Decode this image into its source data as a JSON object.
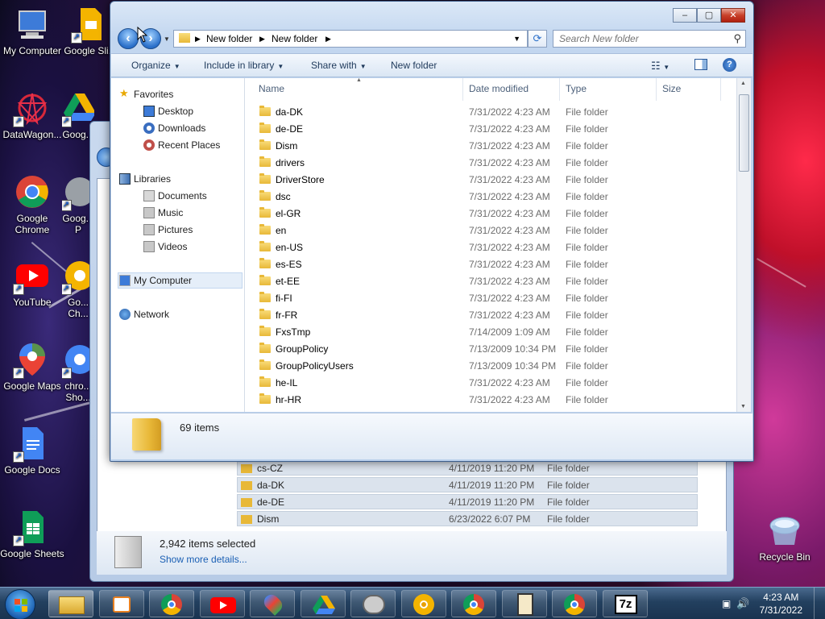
{
  "desktop": {
    "icons": [
      {
        "label": "My Computer",
        "icon": "computer-icon"
      },
      {
        "label": "Google Sli...",
        "icon": "google-slides-icon"
      },
      {
        "label": "DataWagon...",
        "icon": "datawagon-icon"
      },
      {
        "label": "Goog...",
        "icon": "google-drive-icon"
      },
      {
        "label": "Google Chrome",
        "icon": "chrome-icon"
      },
      {
        "label": "Goog... P",
        "icon": "google-pro-icon"
      },
      {
        "label": "YouTube",
        "icon": "youtube-icon"
      },
      {
        "label": "Go... Ch...",
        "icon": "chrome-canary-icon"
      },
      {
        "label": "Google Maps",
        "icon": "google-maps-icon"
      },
      {
        "label": "chro... Sho...",
        "icon": "chrome-shortcut-icon"
      },
      {
        "label": "Google Docs",
        "icon": "google-docs-icon"
      },
      {
        "label": "Google Sheets",
        "icon": "google-sheets-icon"
      },
      {
        "label": "Recycle Bin",
        "icon": "recycle-bin-icon"
      }
    ]
  },
  "bg_window": {
    "rows": [
      {
        "name": "cs-CZ",
        "date": "4/11/2019 11:20 PM",
        "type": "File folder"
      },
      {
        "name": "da-DK",
        "date": "4/11/2019 11:20 PM",
        "type": "File folder"
      },
      {
        "name": "de-DE",
        "date": "4/11/2019 11:20 PM",
        "type": "File folder"
      },
      {
        "name": "Dism",
        "date": "6/23/2022 6:07 PM",
        "type": "File folder"
      }
    ],
    "status": "2,942 items selected",
    "details_link": "Show more details..."
  },
  "window": {
    "controls": {
      "minimize": "–",
      "maximize": "▢",
      "close": "✕"
    },
    "address": {
      "crumb1": "New folder",
      "crumb2": "New folder"
    },
    "search_placeholder": "Search New folder",
    "commands": {
      "organize": "Organize",
      "include": "Include in library",
      "share": "Share with",
      "new_folder": "New folder"
    },
    "nav": {
      "favorites": "Favorites",
      "desktop": "Desktop",
      "downloads": "Downloads",
      "recent": "Recent Places",
      "libraries": "Libraries",
      "documents": "Documents",
      "music": "Music",
      "pictures": "Pictures",
      "videos": "Videos",
      "my_computer": "My Computer",
      "network": "Network"
    },
    "columns": {
      "name": "Name",
      "date": "Date modified",
      "type": "Type",
      "size": "Size"
    },
    "files": [
      {
        "name": "da-DK",
        "date": "7/31/2022 4:23 AM",
        "type": "File folder"
      },
      {
        "name": "de-DE",
        "date": "7/31/2022 4:23 AM",
        "type": "File folder"
      },
      {
        "name": "Dism",
        "date": "7/31/2022 4:23 AM",
        "type": "File folder"
      },
      {
        "name": "drivers",
        "date": "7/31/2022 4:23 AM",
        "type": "File folder"
      },
      {
        "name": "DriverStore",
        "date": "7/31/2022 4:23 AM",
        "type": "File folder"
      },
      {
        "name": "dsc",
        "date": "7/31/2022 4:23 AM",
        "type": "File folder"
      },
      {
        "name": "el-GR",
        "date": "7/31/2022 4:23 AM",
        "type": "File folder"
      },
      {
        "name": "en",
        "date": "7/31/2022 4:23 AM",
        "type": "File folder"
      },
      {
        "name": "en-US",
        "date": "7/31/2022 4:23 AM",
        "type": "File folder"
      },
      {
        "name": "es-ES",
        "date": "7/31/2022 4:23 AM",
        "type": "File folder"
      },
      {
        "name": "et-EE",
        "date": "7/31/2022 4:23 AM",
        "type": "File folder"
      },
      {
        "name": "fi-FI",
        "date": "7/31/2022 4:23 AM",
        "type": "File folder"
      },
      {
        "name": "fr-FR",
        "date": "7/31/2022 4:23 AM",
        "type": "File folder"
      },
      {
        "name": "FxsTmp",
        "date": "7/14/2009 1:09 AM",
        "type": "File folder"
      },
      {
        "name": "GroupPolicy",
        "date": "7/13/2009 10:34 PM",
        "type": "File folder"
      },
      {
        "name": "GroupPolicyUsers",
        "date": "7/13/2009 10:34 PM",
        "type": "File folder"
      },
      {
        "name": "he-IL",
        "date": "7/31/2022 4:23 AM",
        "type": "File folder"
      },
      {
        "name": "hr-HR",
        "date": "7/31/2022 4:23 AM",
        "type": "File folder"
      }
    ],
    "item_count": "69 items"
  },
  "taskbar": {
    "apps": [
      "explorer-icon",
      "media-player-icon",
      "chrome-icon",
      "youtube-icon",
      "google-maps-icon",
      "google-drive-icon",
      "google-pro-icon",
      "chrome-canary-icon",
      "chrome-icon",
      "notepad-icon",
      "chrome-icon",
      "7zip-icon"
    ],
    "sevenzip_label": "7z",
    "time": "4:23 AM",
    "date": "7/31/2022"
  }
}
